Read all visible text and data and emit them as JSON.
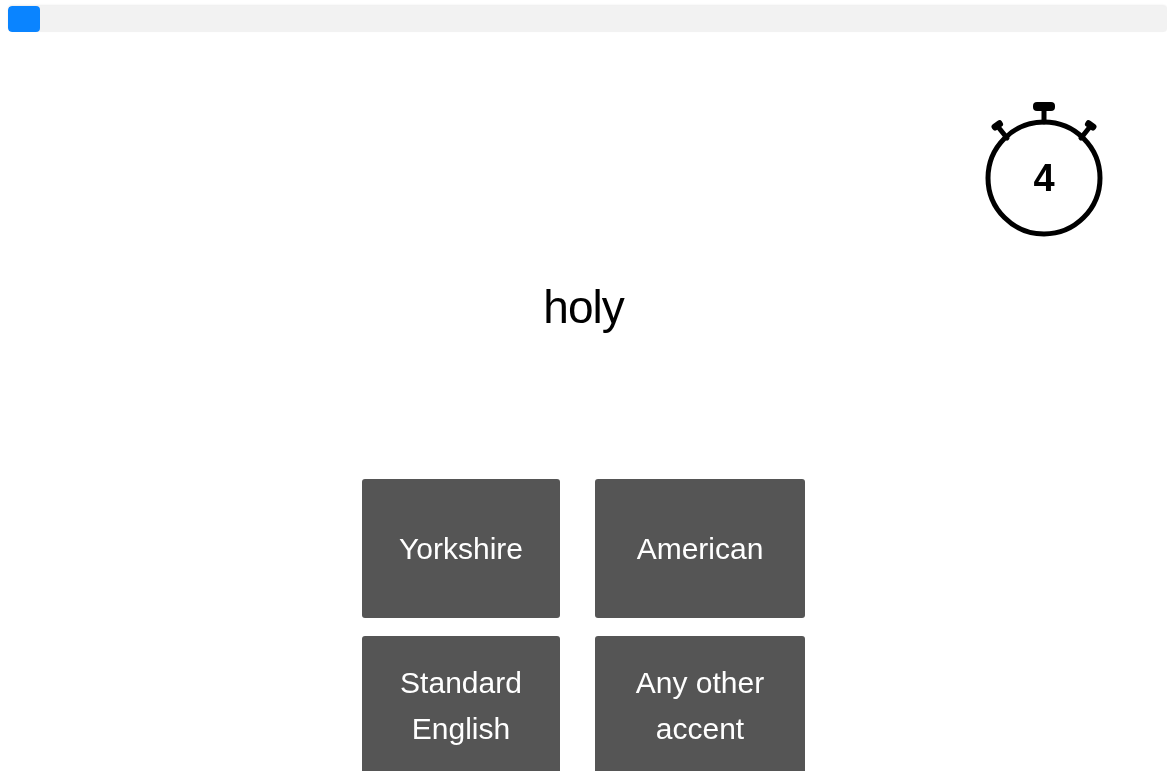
{
  "progress": {
    "level": 0.028
  },
  "timer": {
    "count": "4"
  },
  "word": "holy",
  "answers": [
    {
      "label": "Yorkshire"
    },
    {
      "label": "American"
    },
    {
      "label": "Standard English"
    },
    {
      "label": "Any other accent"
    }
  ]
}
